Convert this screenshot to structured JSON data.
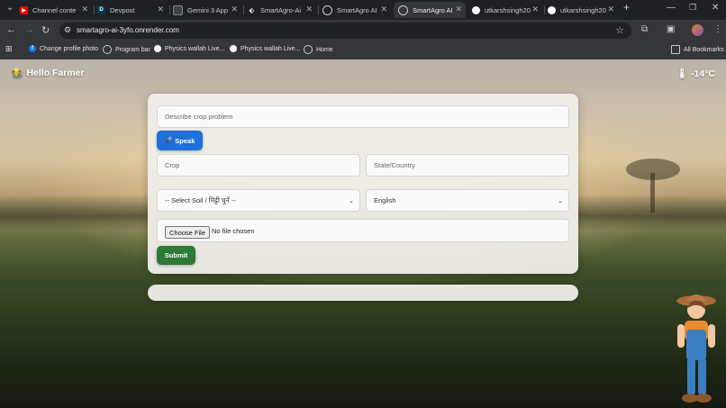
{
  "browser": {
    "tabs": [
      {
        "title": "Channel conte",
        "icon": "youtube-icon",
        "color": "#ff0000"
      },
      {
        "title": "Devpost",
        "icon": "devpost-icon",
        "color": "#003e54"
      },
      {
        "title": "Gemini 3 App",
        "icon": "gemini-icon",
        "color": "#8ab4f8"
      },
      {
        "title": "SmartAgro-Ai",
        "icon": "render-icon",
        "color": "#ffffff"
      },
      {
        "title": "SmartAgro AI",
        "icon": "globe-icon",
        "color": "#c7cbd0"
      },
      {
        "title": "SmartAgro AI",
        "icon": "globe-icon",
        "color": "#c7cbd0"
      },
      {
        "title": "utkarshsingh20",
        "icon": "github-icon",
        "color": "#ffffff"
      },
      {
        "title": "utkarshsingh20",
        "icon": "github-icon",
        "color": "#ffffff"
      }
    ],
    "url": "smartagro-ai-3yfo.onrender.com",
    "bookmarks": [
      {
        "label": "Change profile photo",
        "icon": "facebook-icon",
        "color": "#1877f2"
      },
      {
        "label": "Program bar",
        "icon": "globe-icon",
        "color": "#c7cbd0"
      },
      {
        "label": "Physics wallah Live...",
        "icon": "pw-icon",
        "color": "#ffffff"
      },
      {
        "label": "Physics wallah Live...",
        "icon": "pw-icon",
        "color": "#ffffff"
      },
      {
        "label": "Home",
        "icon": "globe-icon",
        "color": "#c7cbd0"
      }
    ],
    "all_bookmarks": "All Bookmarks"
  },
  "page": {
    "greeting": "Hello Farmer",
    "temperature": "-14°C",
    "form": {
      "problem_placeholder": "Describe crop problem",
      "speak_label": "Speak",
      "crop_placeholder": "Crop",
      "location_placeholder": "State/Country",
      "soil_selected": "-- Select Soil / मिट्टी चुनें --",
      "language_selected": "English",
      "file_button": "Choose File",
      "file_status": "No file chosen",
      "submit_label": "Submit"
    }
  }
}
